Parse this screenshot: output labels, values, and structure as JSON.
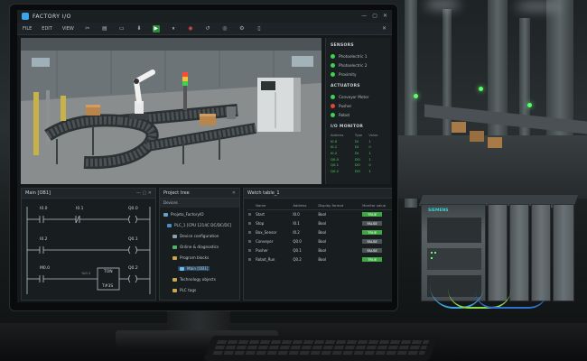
{
  "app": {
    "title": "FACTORY I/O",
    "menu": [
      "FILE",
      "EDIT",
      "VIEW"
    ],
    "window_controls": [
      "—",
      "▢",
      "✕"
    ]
  },
  "sensors": {
    "heading": "SENSORS",
    "items": [
      {
        "label": "Photoelectric 1",
        "color": "#3fd14f"
      },
      {
        "label": "Photoelectric 2",
        "color": "#3fd14f"
      },
      {
        "label": "Proximity",
        "color": "#3fd14f"
      }
    ]
  },
  "actuators": {
    "heading": "ACTUATORS",
    "items": [
      {
        "label": "Conveyor Motor",
        "color": "#3fd14f"
      },
      {
        "label": "Pusher",
        "color": "#e0463c"
      },
      {
        "label": "Robot",
        "color": "#3fd14f"
      }
    ]
  },
  "io_monitor": {
    "heading": "I/O MONITOR",
    "columns": [
      "Address",
      "Type",
      "Value"
    ],
    "rows": [
      [
        "I0.0",
        "DI",
        "1"
      ],
      [
        "I0.1",
        "DI",
        "0"
      ],
      [
        "I0.2",
        "DI",
        "1"
      ],
      [
        "Q0.0",
        "DO",
        "1"
      ],
      [
        "Q0.1",
        "DO",
        "0"
      ],
      [
        "Q0.2",
        "DO",
        "1"
      ]
    ]
  },
  "ladder": {
    "title": "Main [OB1]",
    "contacts": {
      "r1a": "I0.0",
      "r1b": "I0.1",
      "r1coil": "Q0.0",
      "r2a": "I0.2",
      "r2coil": "Q0.1",
      "r3a": "M0.0",
      "r3timer": "TON",
      "r3timer_name": "T#3S",
      "r3coil": "Q0.2",
      "r3small": "%I0.3"
    }
  },
  "project_tree": {
    "title": "Project tree",
    "subtitle": "Devices",
    "items": [
      "Projeto_FactoryIO",
      "PLC_1 [CPU 1214C DC/DC/DC]",
      "Device configuration",
      "Online & diagnostics",
      "Program blocks",
      "Main [OB1]",
      "Technology objects",
      "PLC tags"
    ]
  },
  "watch_table": {
    "title": "Watch table_1",
    "columns": [
      "",
      "Name",
      "Address",
      "Display format",
      "Monitor value"
    ],
    "rows": [
      {
        "name": "Start",
        "address": "I0.0",
        "format": "Bool",
        "value": "TRUE",
        "on": true
      },
      {
        "name": "Stop",
        "address": "I0.1",
        "format": "Bool",
        "value": "FALSE",
        "on": false
      },
      {
        "name": "Box_Sensor",
        "address": "I0.2",
        "format": "Bool",
        "value": "TRUE",
        "on": true
      },
      {
        "name": "Conveyor",
        "address": "Q0.0",
        "format": "Bool",
        "value": "FALSE",
        "on": false
      },
      {
        "name": "Pusher",
        "address": "Q0.1",
        "format": "Bool",
        "value": "FALSE",
        "on": false
      },
      {
        "name": "Robot_Run",
        "address": "Q0.2",
        "format": "Bool",
        "value": "TRUE",
        "on": true
      }
    ]
  },
  "hardware": {
    "brand": "SIEMENS"
  }
}
